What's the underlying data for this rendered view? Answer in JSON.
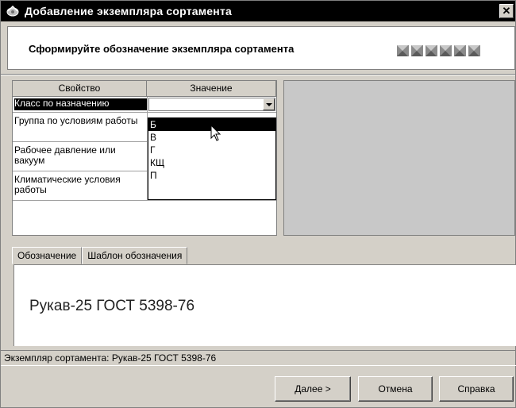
{
  "window": {
    "title": "Добавление экземпляра сортамента",
    "close_label": "✕"
  },
  "header": {
    "prompt": "Сформируйте обозначение экземпляра сортамента",
    "indicator_count": 6
  },
  "grid": {
    "columns": [
      "Свойство",
      "Значение"
    ],
    "rows": [
      {
        "name": "Класс по назначению",
        "value": ""
      },
      {
        "name": "Группа по условиям работы",
        "value": ""
      },
      {
        "name": "Рабочее давление или вакуум",
        "value": ""
      },
      {
        "name": "Климатические условия работы",
        "value": ""
      }
    ]
  },
  "dropdown": {
    "options": [
      "Б",
      "В",
      "Г",
      "КЩ",
      "П"
    ],
    "selected": "Б"
  },
  "tabs": [
    {
      "label": "Обозначение",
      "active": true
    },
    {
      "label": "Шаблон обозначения",
      "active": false
    }
  ],
  "designation": "Рукав-25 ГОСТ 5398-76",
  "status": "Экземпляр сортамента: Рукав-25 ГОСТ 5398-76",
  "buttons": {
    "next": "Далее >",
    "cancel": "Отмена",
    "help": "Справка"
  }
}
